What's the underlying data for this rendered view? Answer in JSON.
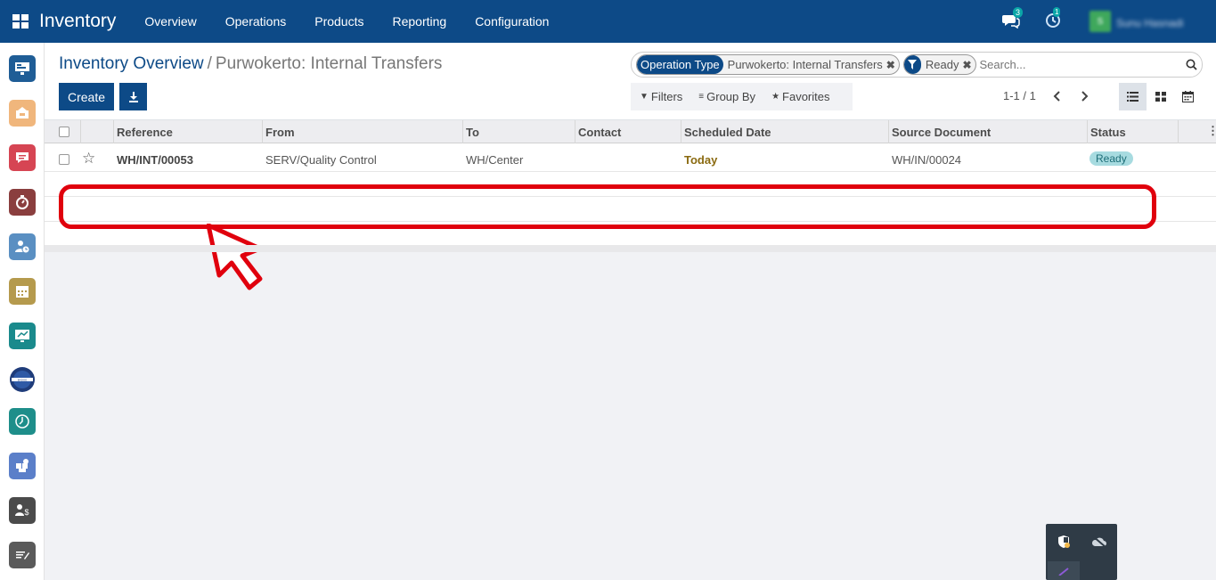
{
  "topbar": {
    "app_title": "Inventory",
    "menu": [
      "Overview",
      "Operations",
      "Products",
      "Reporting",
      "Configuration"
    ],
    "chat_count": "3",
    "activity_count": "1",
    "avatar_initial": "S",
    "username": "Sunu Hasnadi"
  },
  "breadcrumb": {
    "parent": "Inventory Overview",
    "separator": "/",
    "current": "Purwokerto: Internal Transfers"
  },
  "buttons": {
    "create": "Create"
  },
  "search": {
    "facets": [
      {
        "label": "Operation Type",
        "value": "Purwokerto: Internal Transfers",
        "remove": "✖"
      },
      {
        "label": "",
        "value": "Ready",
        "remove": "✖"
      }
    ],
    "placeholder": "Search..."
  },
  "filters": {
    "filters": "Filters",
    "group_by": "Group By",
    "favorites": "Favorites"
  },
  "pager": {
    "value": "1-1 / 1"
  },
  "table": {
    "columns": [
      "Reference",
      "From",
      "To",
      "Contact",
      "Scheduled Date",
      "Source Document",
      "Status"
    ],
    "rows": [
      {
        "reference": "WH/INT/00053",
        "from": "SERV/Quality Control",
        "to": "WH/Center",
        "contact": "",
        "scheduled_date": "Today",
        "source_document": "WH/IN/00024",
        "status": "Ready"
      }
    ]
  },
  "colors": {
    "brand": "#0d4a87",
    "highlight": "#e0000d",
    "status_ready": "#a7dbe0"
  },
  "icons": {
    "apps": "grid-icon",
    "chat": "chat-icon",
    "activity": "clock-icon",
    "download": "download-icon",
    "search": "search-icon",
    "filter": "filter-icon",
    "group": "list-icon",
    "favorite": "star-icon"
  }
}
